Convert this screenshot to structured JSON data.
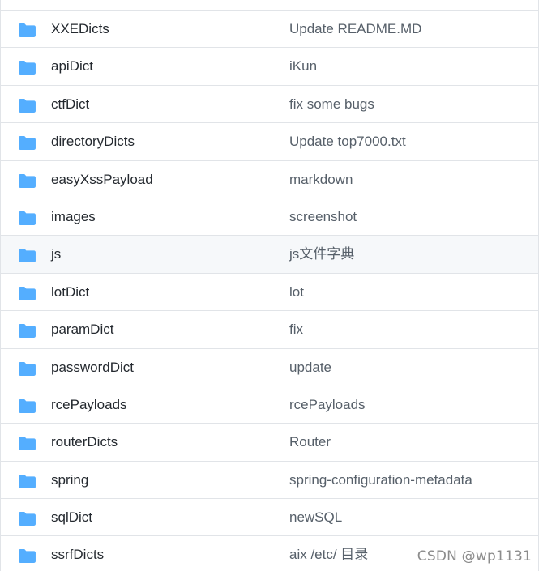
{
  "colors": {
    "folder": "#54aeff",
    "border": "#e1e4e8",
    "row_highlight": "#f6f8fa"
  },
  "rows": [
    {
      "icon": "folder-icon",
      "name": "XXEDicts",
      "message": "Update README.MD"
    },
    {
      "icon": "folder-icon",
      "name": "apiDict",
      "message": "iKun"
    },
    {
      "icon": "folder-icon",
      "name": "ctfDict",
      "message": "fix some bugs"
    },
    {
      "icon": "folder-icon",
      "name": "directoryDicts",
      "message": "Update top7000.txt"
    },
    {
      "icon": "folder-icon",
      "name": "easyXssPayload",
      "message": "markdown"
    },
    {
      "icon": "folder-icon",
      "name": "images",
      "message": "screenshot"
    },
    {
      "icon": "folder-icon",
      "name": "js",
      "message": "js文件字典"
    },
    {
      "icon": "folder-icon",
      "name": "lotDict",
      "message": "lot"
    },
    {
      "icon": "folder-icon",
      "name": "paramDict",
      "message": "fix"
    },
    {
      "icon": "folder-icon",
      "name": "passwordDict",
      "message": "update"
    },
    {
      "icon": "folder-icon",
      "name": "rcePayloads",
      "message": "rcePayloads"
    },
    {
      "icon": "folder-icon",
      "name": "routerDicts",
      "message": "Router"
    },
    {
      "icon": "folder-icon",
      "name": "spring",
      "message": "spring-configuration-metadata"
    },
    {
      "icon": "folder-icon",
      "name": "sqlDict",
      "message": "newSQL"
    },
    {
      "icon": "folder-icon",
      "name": "ssrfDicts",
      "message": "aix /etc/ 目录"
    }
  ],
  "watermark": "CSDN @wp1131"
}
